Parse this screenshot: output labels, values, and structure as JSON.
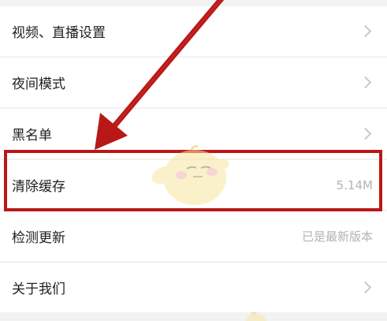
{
  "settings": {
    "items": [
      {
        "label": "视频、直播设置",
        "value": "",
        "chevron": true
      },
      {
        "label": "夜间模式",
        "value": "",
        "chevron": true
      },
      {
        "label": "黑名单",
        "value": "",
        "chevron": true
      },
      {
        "label": "清除缓存",
        "value": "5.14M",
        "chevron": false
      },
      {
        "label": "检测更新",
        "value": "已是最新版本",
        "chevron": false
      },
      {
        "label": "关于我们",
        "value": "",
        "chevron": true
      }
    ]
  },
  "annotation": {
    "color": "#b91818",
    "arrow_icon": "arrow-down-left-icon",
    "highlight_target": "清除缓存"
  },
  "watermark": {
    "icon": "mascot-icon"
  }
}
